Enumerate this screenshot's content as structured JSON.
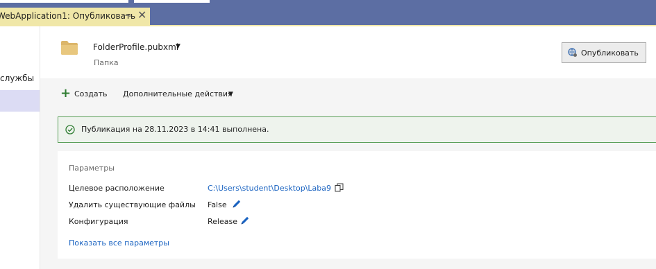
{
  "tab": {
    "title": "WebApplication1: Опубликовать",
    "pin_glyph": "⊸",
    "close_glyph": "✕"
  },
  "sidebar": {
    "label": "службы"
  },
  "header": {
    "profile_name": "FolderProfile.pubxml",
    "profile_type": "Папка",
    "publish_label": "Опубликовать"
  },
  "actions": {
    "create_label": "Создать",
    "more_label": "Дополнительные действия"
  },
  "status": {
    "message": "Публикация на 28.11.2023 в 14:41 выполнена."
  },
  "parameters": {
    "title": "Параметры",
    "rows": [
      {
        "label": "Целевое расположение",
        "value": "C:\\Users\\student\\Desktop\\Laba9"
      },
      {
        "label": "Удалить существующие файлы",
        "value": "False"
      },
      {
        "label": "Конфигурация",
        "value": "Release"
      }
    ],
    "show_all_label": "Показать все параметры"
  },
  "colors": {
    "tabbar": "#5c6ea3",
    "active_tab": "#f0e7a8",
    "link": "#1a63c1",
    "success": "#2f7d32",
    "edit_icon": "#1a63c1",
    "folder": "#dcb66a"
  }
}
